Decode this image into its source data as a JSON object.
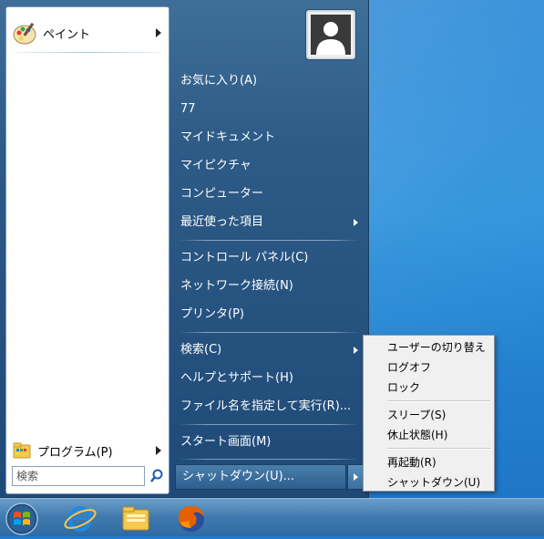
{
  "start_menu": {
    "pinned": [
      {
        "label": "ペイント",
        "icon": "paint-icon"
      }
    ],
    "programs_label": "プログラム(P)",
    "search_placeholder": "検索",
    "user_faint_text": "",
    "right_items": [
      {
        "label": "お気に入り(A)",
        "has_submenu": false
      },
      {
        "label": "77",
        "has_submenu": false
      },
      {
        "label": "マイドキュメント",
        "has_submenu": false
      },
      {
        "label": "マイピクチャ",
        "has_submenu": false
      },
      {
        "label": "コンピューター",
        "has_submenu": false
      },
      {
        "label": "最近使った項目",
        "has_submenu": true
      },
      {
        "label": "コントロール パネル(C)",
        "has_submenu": false
      },
      {
        "label": "ネットワーク接続(N)",
        "has_submenu": false
      },
      {
        "label": "プリンタ(P)",
        "has_submenu": false
      },
      {
        "label": "検索(C)",
        "has_submenu": true
      },
      {
        "label": "ヘルプとサポート(H)",
        "has_submenu": false
      },
      {
        "label": "ファイル名を指定して実行(R)...",
        "has_submenu": false
      },
      {
        "label": "スタート画面(M)",
        "has_submenu": false
      }
    ],
    "shutdown_label": "シャットダウン(U)..."
  },
  "shutdown_submenu": {
    "groups": [
      [
        "ユーザーの切り替え",
        "ログオフ",
        "ロック"
      ],
      [
        "スリープ(S)",
        "休止状態(H)"
      ],
      [
        "再起動(R)",
        "シャットダウン(U)"
      ]
    ]
  },
  "taskbar": {
    "items": [
      "start-orb-icon",
      "internet-explorer-icon",
      "file-explorer-icon",
      "firefox-icon"
    ]
  },
  "colors": {
    "menu_blue": "#2d5a86",
    "desktop_blue": "#2a8ed9",
    "submenu_bg": "#f0f0f0"
  }
}
